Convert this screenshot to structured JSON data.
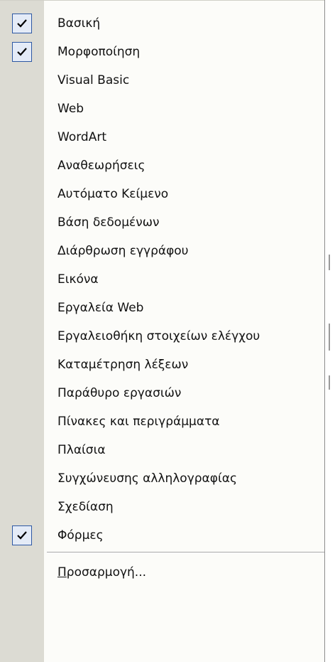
{
  "menu": {
    "items": [
      {
        "label": "Βασική",
        "checked": true
      },
      {
        "label": "Μορφοποίηση",
        "checked": true
      },
      {
        "label": "Visual Basic",
        "checked": false
      },
      {
        "label": "Web",
        "checked": false
      },
      {
        "label": "WordArt",
        "checked": false
      },
      {
        "label": "Αναθεωρήσεις",
        "checked": false
      },
      {
        "label": "Αυτόματο Κείμενο",
        "checked": false
      },
      {
        "label": "Βάση δεδομένων",
        "checked": false
      },
      {
        "label": "Διάρθρωση εγγράφου",
        "checked": false
      },
      {
        "label": "Εικόνα",
        "checked": false
      },
      {
        "label": "Εργαλεία Web",
        "checked": false
      },
      {
        "label": "Εργαλειοθήκη στοιχείων ελέγχου",
        "checked": false
      },
      {
        "label": "Καταμέτρηση λέξεων",
        "checked": false
      },
      {
        "label": "Παράθυρο εργασιών",
        "checked": false
      },
      {
        "label": "Πίνακες και περιγράμματα",
        "checked": false
      },
      {
        "label": "Πλαίσια",
        "checked": false
      },
      {
        "label": "Συγχώνευσης αλληλογραφίας",
        "checked": false
      },
      {
        "label": "Σχεδίαση",
        "checked": false
      },
      {
        "label": "Φόρμες",
        "checked": true
      }
    ],
    "customize": {
      "access_key": "Π",
      "rest": "ροσαρμογή..."
    }
  }
}
